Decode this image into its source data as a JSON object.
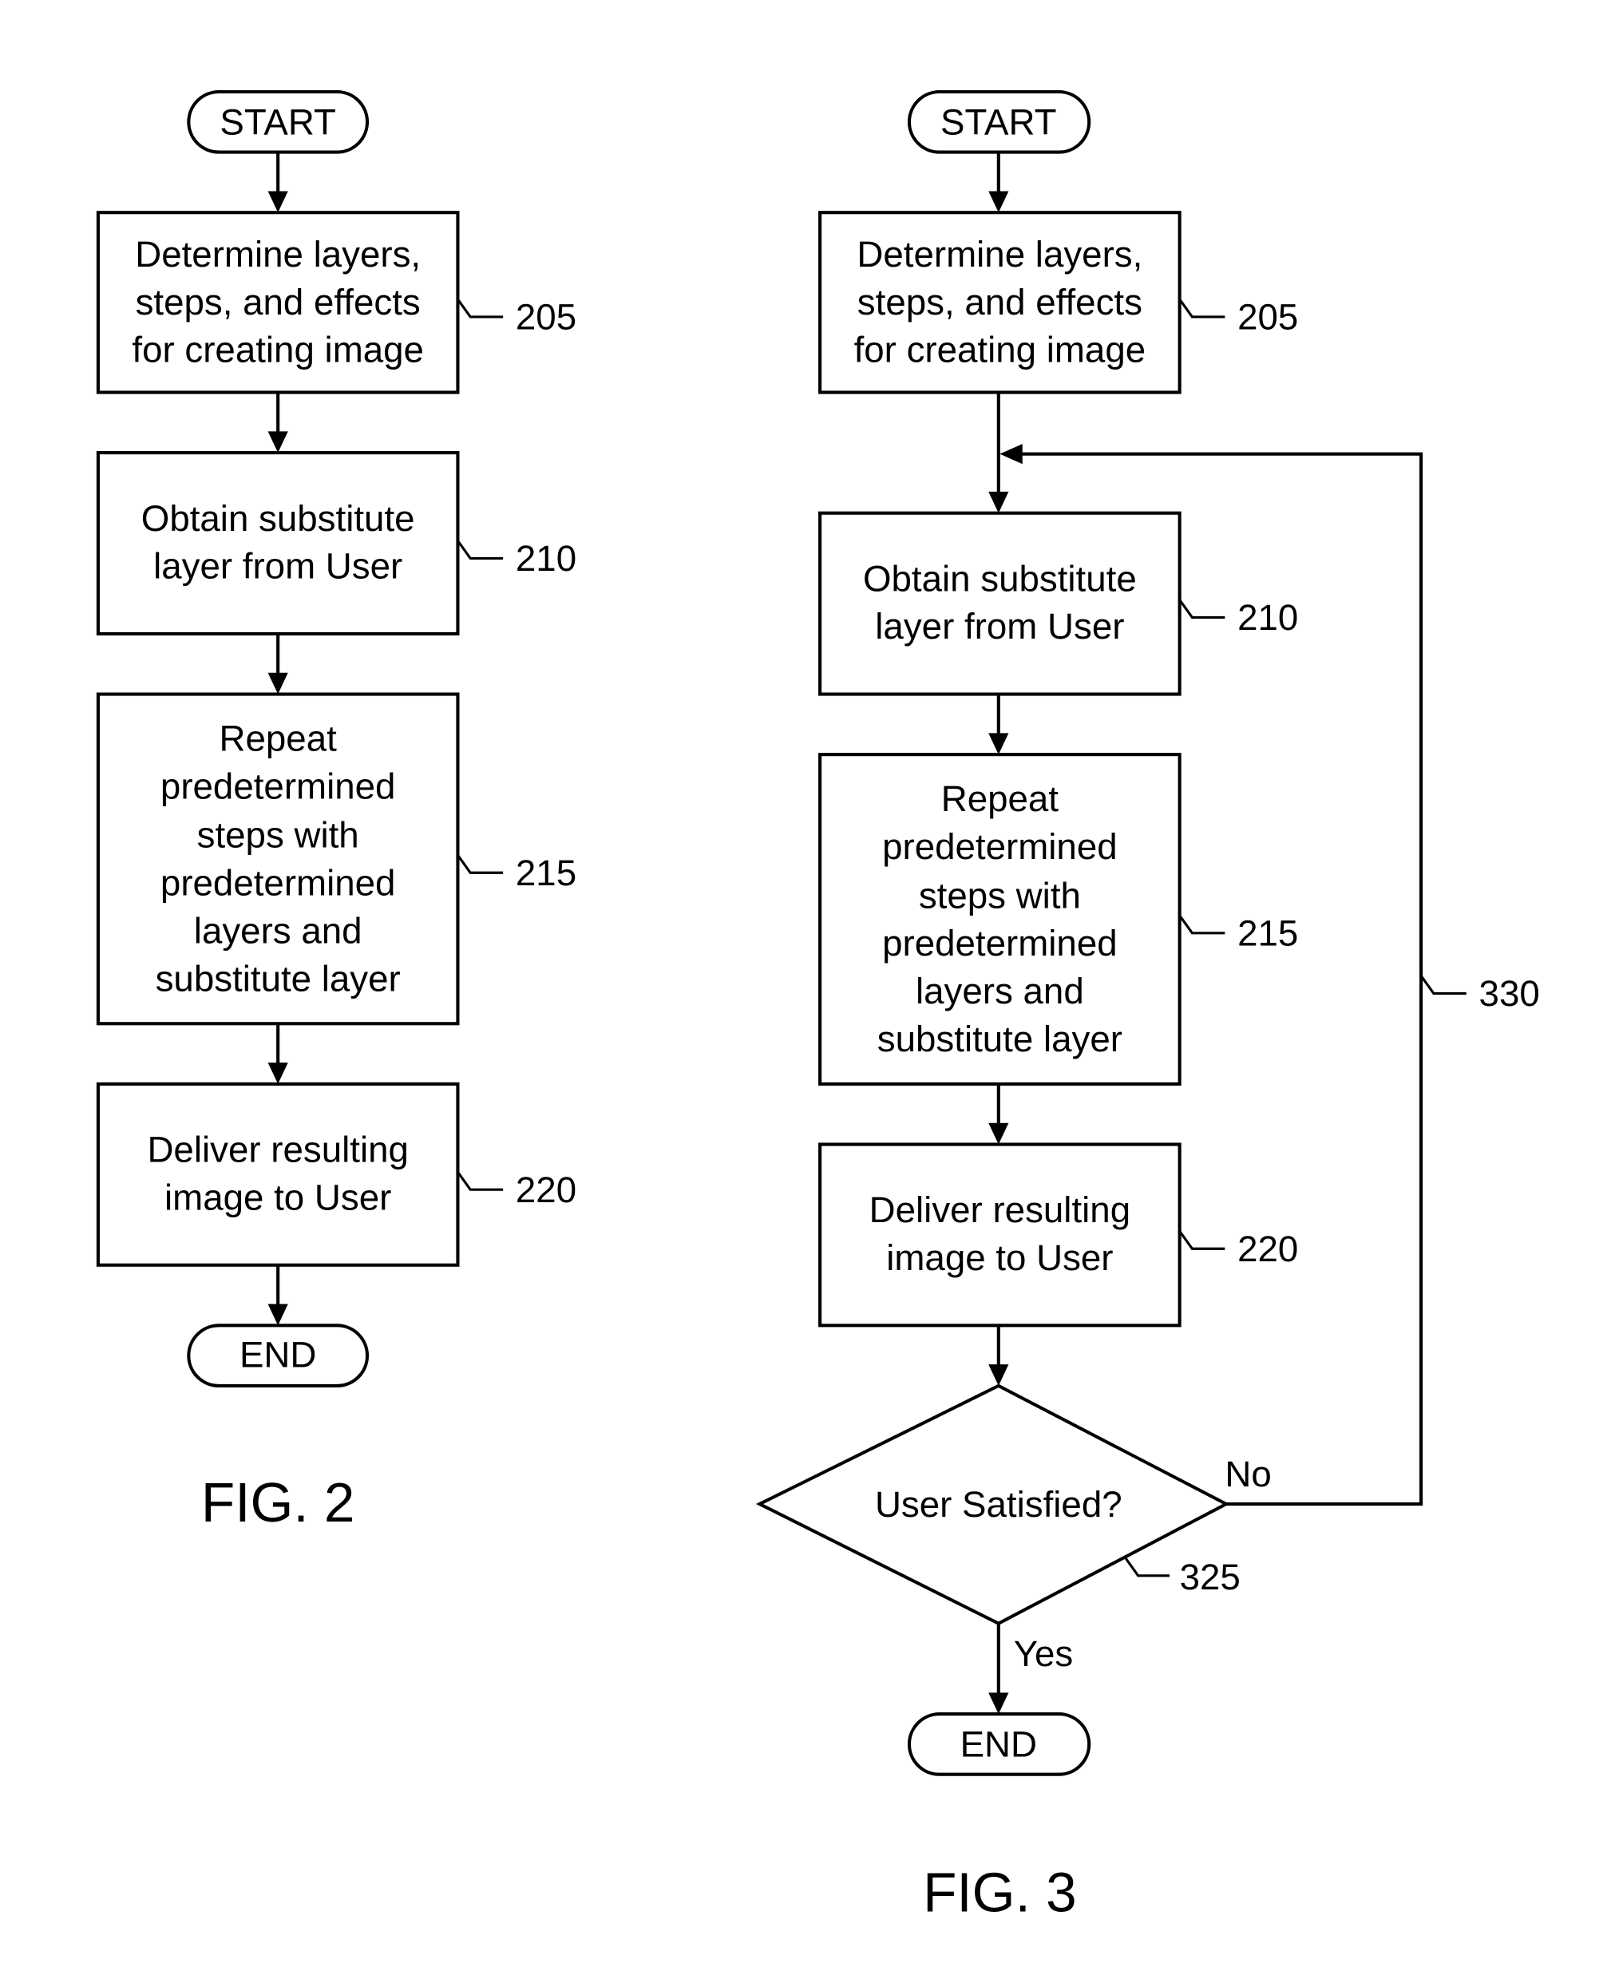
{
  "figures": [
    {
      "caption": "FIG. 2",
      "start": "START",
      "end": "END",
      "steps": [
        {
          "ref": "205",
          "lines": [
            "Determine layers,",
            "steps, and effects",
            "for creating image"
          ]
        },
        {
          "ref": "210",
          "lines": [
            "Obtain substitute",
            "layer from User"
          ]
        },
        {
          "ref": "215",
          "lines": [
            "Repeat",
            "predetermined",
            "steps with",
            "predetermined",
            "layers and",
            "substitute layer"
          ]
        },
        {
          "ref": "220",
          "lines": [
            "Deliver resulting",
            "image to User"
          ]
        }
      ]
    },
    {
      "caption": "FIG. 3",
      "start": "START",
      "end": "END",
      "steps": [
        {
          "ref": "205",
          "lines": [
            "Determine layers,",
            "steps, and effects",
            "for creating image"
          ]
        },
        {
          "ref": "210",
          "lines": [
            "Obtain substitute",
            "layer from User"
          ]
        },
        {
          "ref": "215",
          "lines": [
            "Repeat",
            "predetermined",
            "steps with",
            "predetermined",
            "layers and",
            "substitute layer"
          ]
        },
        {
          "ref": "220",
          "lines": [
            "Deliver resulting",
            "image to User"
          ]
        }
      ],
      "decision": {
        "ref": "325",
        "label": "User Satisfied?",
        "no_label": "No",
        "yes_label": "Yes"
      },
      "loop": {
        "ref": "330"
      }
    }
  ]
}
